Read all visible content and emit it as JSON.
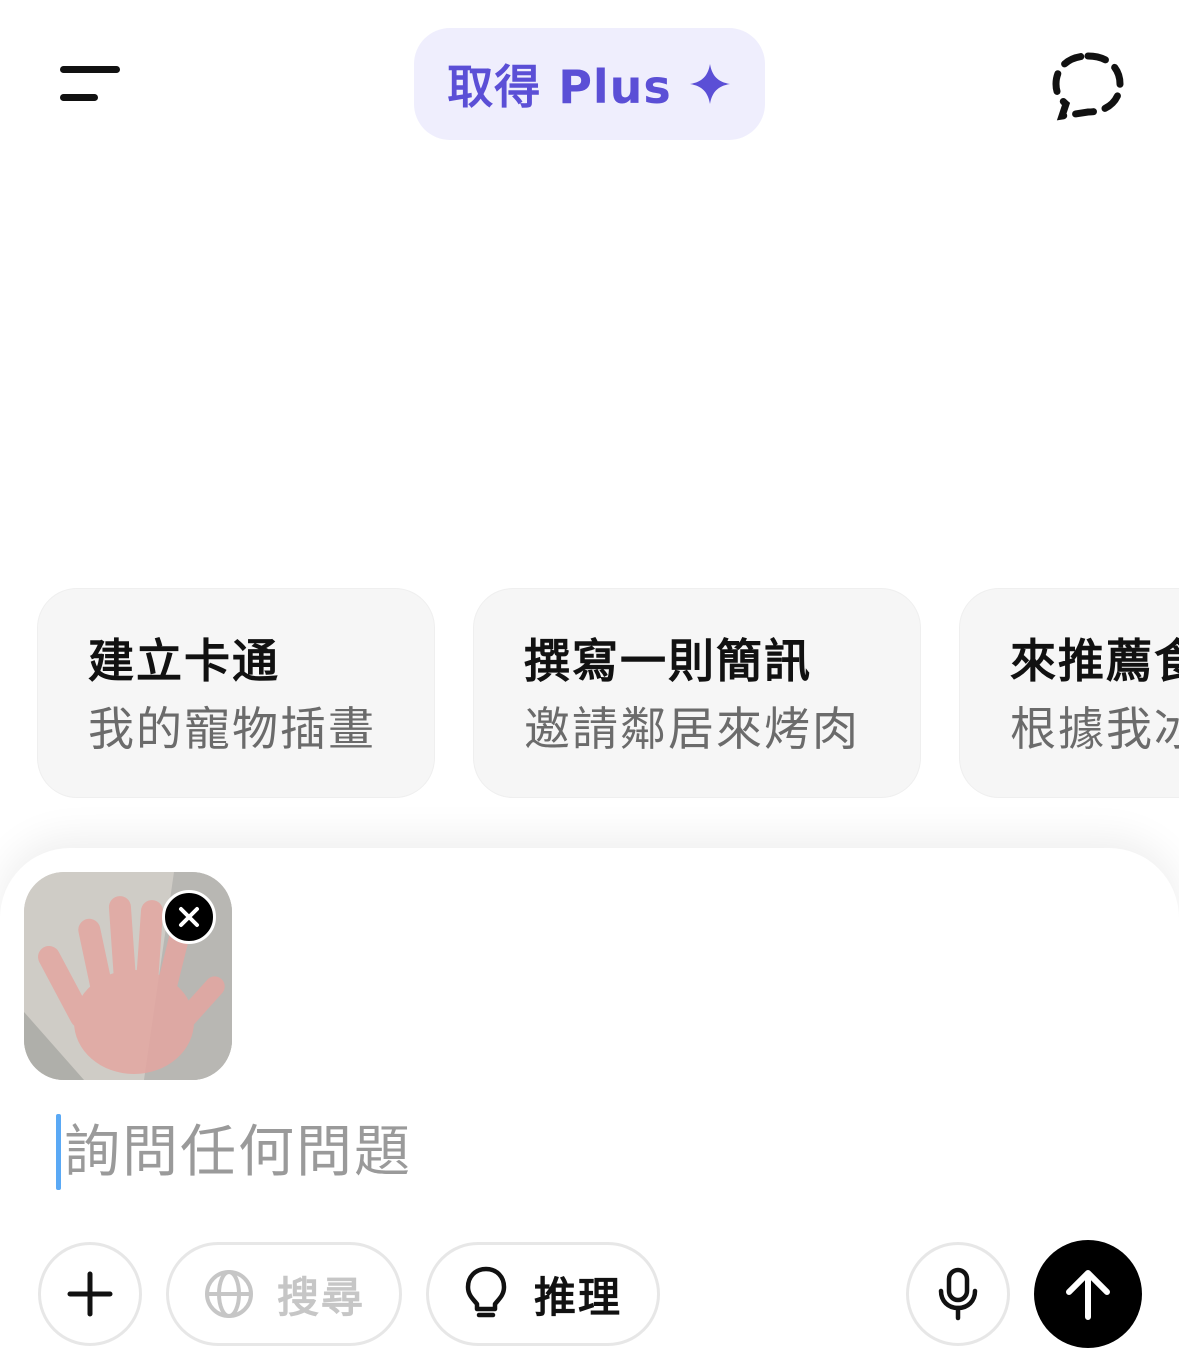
{
  "header": {
    "menu_icon": "menu-icon",
    "upgrade_label": "取得 Plus",
    "upgrade_icon": "sparkle-icon",
    "new_chat_icon": "dashed-chat-icon",
    "accent_color": "#5b4fd6"
  },
  "suggestions": [
    {
      "title": "建立卡通",
      "subtitle": "我的寵物插畫"
    },
    {
      "title": "撰寫一則簡訊",
      "subtitle": "邀請鄰居來烤肉"
    },
    {
      "title": "來推薦食",
      "subtitle": "根據我冰"
    }
  ],
  "composer": {
    "attachment_icon": "hand-photo-thumbnail",
    "remove_icon": "close-icon",
    "input_placeholder": "詢問任何問題",
    "input_value": ""
  },
  "toolbar": {
    "add_icon": "plus-icon",
    "search_icon": "globe-icon",
    "search_label": "搜尋",
    "reason_icon": "lightbulb-icon",
    "reason_label": "推理",
    "mic_icon": "microphone-icon",
    "send_icon": "arrow-up-icon"
  }
}
